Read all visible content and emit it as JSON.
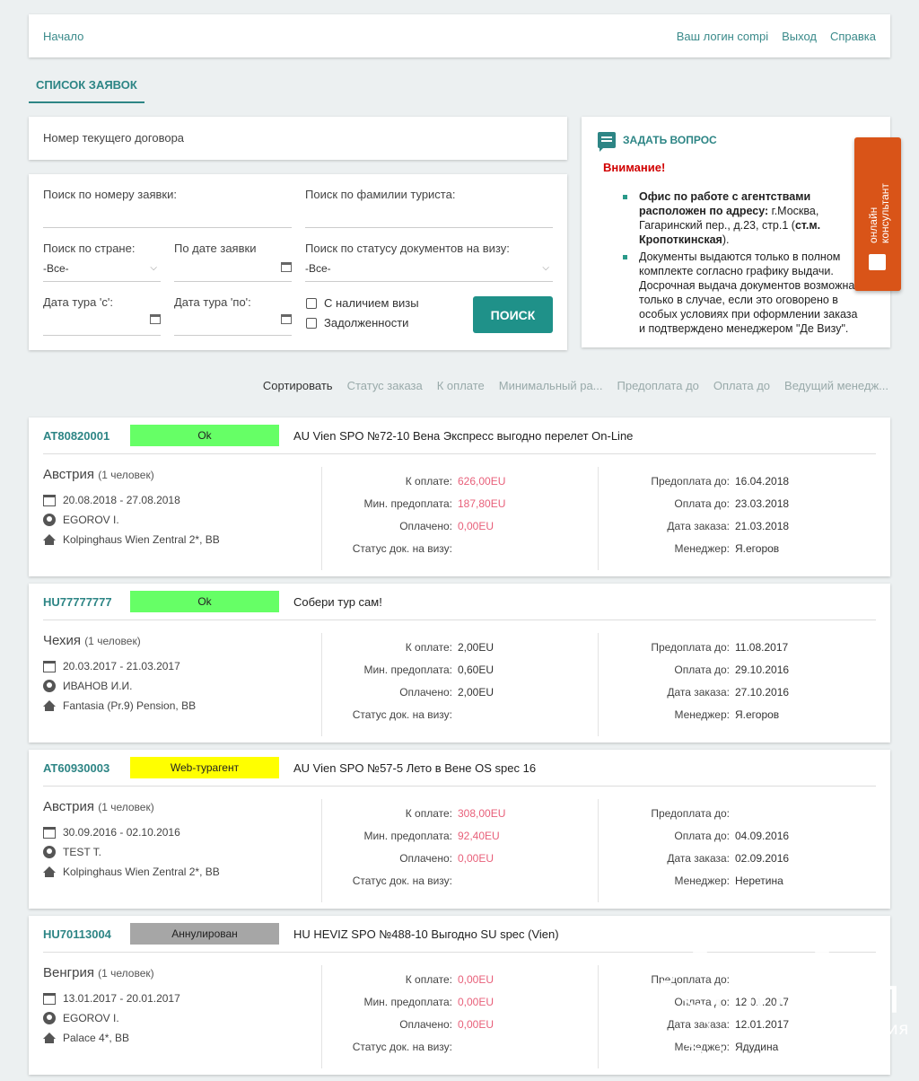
{
  "topbar": {
    "home": "Начало",
    "login": "Ваш логин compi",
    "logout": "Выход",
    "help": "Справка"
  },
  "tab": {
    "label": "Список заявок"
  },
  "contract": {
    "label": "Номер текущего договора"
  },
  "search": {
    "by_number": "Поиск по номеру заявки:",
    "by_surname": "Поиск по фамилии туриста:",
    "by_country": "Поиск по стране:",
    "country_value": "-Все-",
    "by_date": "По дате заявки",
    "by_visa_status": "Поиск по статусу документов на визу:",
    "visa_status_value": "-Все-",
    "tour_from": "Дата тура 'с':",
    "tour_to": "Дата тура 'по':",
    "with_visa": "С наличием визы",
    "debts": "Задолженности",
    "button": "Поиск"
  },
  "notice": {
    "ask": "Задать вопрос",
    "warning": "Внимание!",
    "item1_bold": "Офис по работе с агентствами расположен по адресу:",
    "item1_text": " г.Москва, Гагаринский пер., д.23, стр.1 (",
    "item1_metro": "ст.м. Кропоткинская",
    "item1_end": ").",
    "item2": "Документы выдаются только в полном комплекте согласно графику выдачи. Досрочная выдача документов возможна только в случае, если это оговорено в особых условиях при оформлении заказа и подтверждено менеджером \"Де Визу\"."
  },
  "consultant": {
    "line1": "онлайн",
    "line2": "консультант"
  },
  "sort": {
    "label": "Сортировать",
    "options": [
      "Статус заказа",
      "К оплате",
      "Минимальный ра...",
      "Предоплата до",
      "Оплата до",
      "Ведущий менедж..."
    ]
  },
  "labels": {
    "to_pay": "К оплате:",
    "min_prepay": "Мин. предоплата:",
    "paid": "Оплачено:",
    "visa_status": "Статус док. на визу:",
    "prepay_until": "Предоплата до:",
    "pay_until": "Оплата до:",
    "order_date": "Дата заказа:",
    "manager": "Менеджер:"
  },
  "orders": [
    {
      "number": "AT80820001",
      "status": "Ok",
      "status_color": "#66ff66",
      "tour": "AU Vien SPO №72-10 Вена Экспресс выгодно перелет On-Line",
      "country": "Австрия",
      "people": "(1 человек)",
      "dates": "20.08.2018 - 27.08.2018",
      "tourist": "EGOROV I.",
      "hotel": "Kolpinghaus Wien Zentral 2*, BB",
      "to_pay": "626,00EU",
      "min_prepay": "187,80EU",
      "paid": "0,00EU",
      "visa_status": "",
      "prepay_until": "16.04.2018",
      "pay_until": "23.03.2018",
      "order_date": "21.03.2018",
      "manager": "Я.егоров",
      "pink": true
    },
    {
      "number": "HU77777777",
      "status": "Ok",
      "status_color": "#66ff66",
      "tour": "Собери тур сам!",
      "country": "Чехия",
      "people": "(1 человек)",
      "dates": "20.03.2017 - 21.03.2017",
      "tourist": "ИВАНОВ И.И.",
      "hotel": "Fantasia (Pr.9) Pension, BB",
      "to_pay": "2,00EU",
      "min_prepay": "0,60EU",
      "paid": "2,00EU",
      "visa_status": "",
      "prepay_until": "11.08.2017",
      "pay_until": "29.10.2016",
      "order_date": "27.10.2016",
      "manager": "Я.егоров",
      "pink": false
    },
    {
      "number": "AT60930003",
      "status": "Web-турагент",
      "status_color": "#ffff00",
      "tour": "AU Vien SPO №57-5 Лето в Вене OS spec 16",
      "country": "Австрия",
      "people": "(1 человек)",
      "dates": "30.09.2016 - 02.10.2016",
      "tourist": "TEST T.",
      "hotel": "Kolpinghaus Wien Zentral 2*, BB",
      "to_pay": "308,00EU",
      "min_prepay": "92,40EU",
      "paid": "0,00EU",
      "visa_status": "",
      "prepay_until": "",
      "pay_until": "04.09.2016",
      "order_date": "02.09.2016",
      "manager": "Неретина",
      "pink": true
    },
    {
      "number": "HU70113004",
      "status": "Аннулирован",
      "status_color": "#a6a6a6",
      "tour": "HU HEVIZ SPO №488-10 Выгодно SU spec (Vien)",
      "country": "Венгрия",
      "people": "(1 человек)",
      "dates": "13.01.2017 - 20.01.2017",
      "tourist": "EGOROV I.",
      "hotel": "Palace 4*, BB",
      "to_pay": "0,00EU",
      "min_prepay": "0,00EU",
      "paid": "0,00EU",
      "visa_status": "",
      "prepay_until": "",
      "pay_until": "12.01.2017",
      "order_date": "12.01.2017",
      "manager": "Ядудина",
      "pink": true
    }
  ],
  "watermark": {
    "brand": "фоксел",
    "tagline": "веб студия"
  }
}
